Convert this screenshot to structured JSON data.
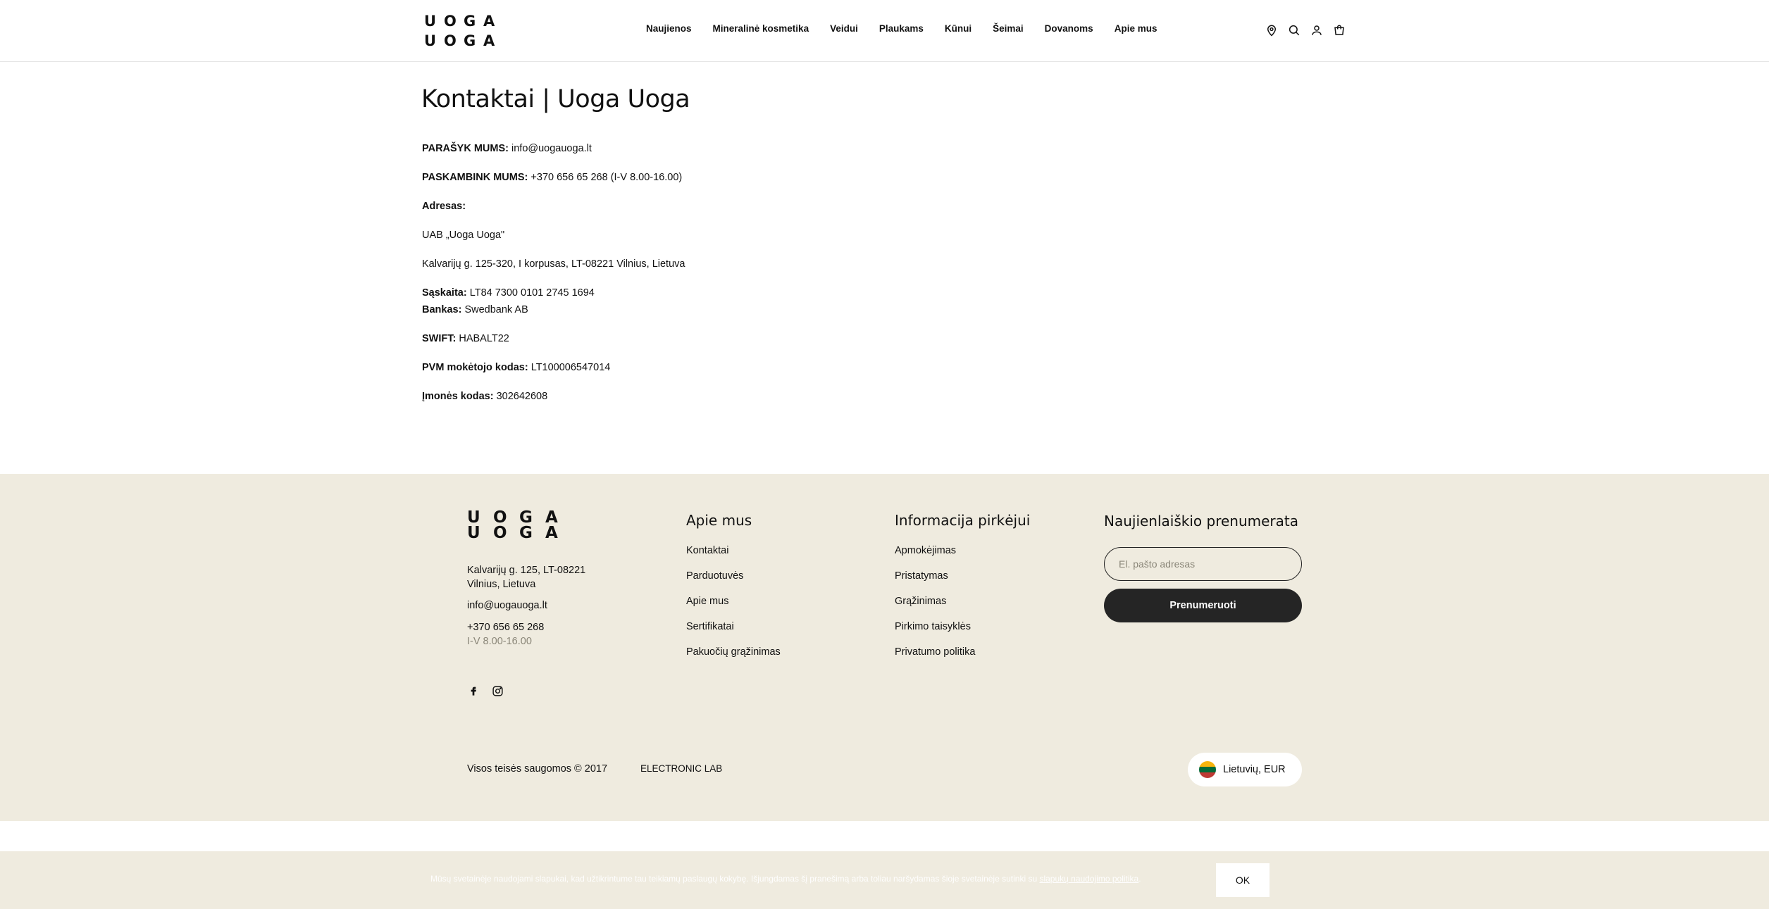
{
  "logo": {
    "letters": [
      "U",
      "O",
      "G",
      "A",
      "U",
      "O",
      "G",
      "A"
    ]
  },
  "nav": {
    "items": [
      "Naujienos",
      "Mineralinė kosmetika",
      "Veidui",
      "Plaukams",
      "Kūnui",
      "Šeimai",
      "Dovanoms",
      "Apie mus"
    ]
  },
  "header_icons": [
    "location-pin-icon",
    "search-icon",
    "user-icon",
    "cart-icon"
  ],
  "page": {
    "title": "Kontaktai | Uoga Uoga",
    "email_label": "PARAŠYK MUMS:",
    "email_value": "info@uogauoga.lt",
    "phone_label": "PASKAMBINK MUMS:",
    "phone_value": "+370 656 65 268 (I-V 8.00-16.00)",
    "address_label": "Adresas:",
    "company": "UAB „Uoga Uoga\"",
    "address": "Kalvarijų g. 125-320, I korpusas, LT-08221 Vilnius, Lietuva",
    "account_label": "Sąskaita:",
    "account_value": "LT84 7300 0101 2745 1694",
    "bank_label": "Bankas:",
    "bank_value": "Swedbank AB",
    "swift_label": "SWIFT:",
    "swift_value": "HABALT22",
    "vat_label": "PVM mokėtojo kodas:",
    "vat_value": "LT100006547014",
    "company_code_label": "Įmonės kodas:",
    "company_code_value": "302642608"
  },
  "footer": {
    "address_line1": "Kalvarijų g. 125, LT-08221",
    "address_line2": "Vilnius, Lietuva",
    "email": "info@uogauoga.lt",
    "phone": "+370 656 65 268",
    "hours": "I-V 8.00-16.00",
    "col_about": {
      "heading": "Apie mus",
      "links": [
        "Kontaktai",
        "Parduotuvės",
        "Apie mus",
        "Sertifikatai",
        "Pakuočių grąžinimas"
      ]
    },
    "col_info": {
      "heading": "Informacija pirkėjui",
      "links": [
        "Apmokėjimas",
        "Pristatymas",
        "Grąžinimas",
        "Pirkimo taisyklės",
        "Privatumo politika"
      ]
    },
    "newsletter": {
      "heading": "Naujienlaiškio prenumerata",
      "placeholder": "El. pašto adresas",
      "button": "Prenumeruoti"
    },
    "social_icons": [
      "facebook-icon",
      "instagram-icon"
    ],
    "copyright": "Visos teisės saugomos © 2017",
    "credit": "ELECTRONIC LAB",
    "language": "Lietuvių, EUR",
    "flag_colors": [
      "#f6b40e",
      "#046a38",
      "#be3a34"
    ]
  },
  "cookie": {
    "text": "Mūsų svetainėje naudojami slapukai, kad užtikrintume tau teikiamų paslaugų kokybę. Išjungdamas šį pranešimą arba toliau naršydamas šioje svetainėje sutinki su",
    "link": "slapukų naudojimo politika",
    "ok": "OK"
  }
}
